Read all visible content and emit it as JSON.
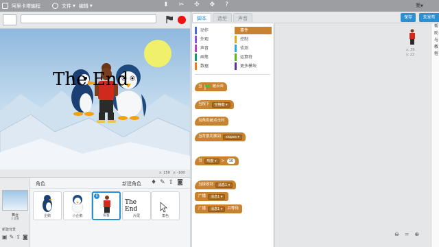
{
  "menubar": {
    "app_name": "阿里卡塔編程",
    "file_label": "文件",
    "edit_label": "编辑",
    "user_label": "我"
  },
  "stage": {
    "overlay_text": "The End",
    "mouse_x_label": "x:",
    "mouse_x": "150",
    "mouse_y_label": "y:",
    "mouse_y": "-100"
  },
  "stage_panel": {
    "name": "舞台",
    "backdrops": "3 背景",
    "new_backdrop": "新建背景"
  },
  "sprites": {
    "title": "角色",
    "new_sprite": "新建角色",
    "items": [
      {
        "name": "企鹅"
      },
      {
        "name": "小企鹅"
      },
      {
        "name": "说客"
      },
      {
        "name": "片尾",
        "thumb_text": "The End"
      },
      {
        "name": "角色"
      }
    ]
  },
  "tabs": {
    "scripts": "脚本",
    "costumes": "造型",
    "sounds": "声音"
  },
  "categories": [
    {
      "label": "动作",
      "color": "#4a6cd4"
    },
    {
      "label": "事件",
      "color": "#c88330",
      "selected": true
    },
    {
      "label": "外观",
      "color": "#8a55d7"
    },
    {
      "label": "控制",
      "color": "#e1a91a"
    },
    {
      "label": "声音",
      "color": "#bb42c3"
    },
    {
      "label": "侦测",
      "color": "#2ca5e2"
    },
    {
      "label": "画笔",
      "color": "#0e9a6c"
    },
    {
      "label": "运算符",
      "color": "#5cb712"
    },
    {
      "label": "数据",
      "color": "#ee7d16"
    },
    {
      "label": "更多模块",
      "color": "#632d99"
    }
  ],
  "blocks": {
    "when_flag_pre": "当",
    "when_flag_post": "被点击",
    "when_key_pre": "当按下",
    "when_key_value": "空格键",
    "when_sprite_clicked": "当角色被点击时",
    "when_backdrop_pre": "当背景切换到",
    "when_backdrop_value": "slopes",
    "when_loudness_pre": "当",
    "when_loudness_value": "响度",
    "when_loudness_op": ">",
    "when_loudness_num": "10",
    "when_receive_pre": "当接收到",
    "when_receive_value": "消息1",
    "broadcast_pre": "广播",
    "broadcast_value": "消息1",
    "broadcast_wait_pre": "广播",
    "broadcast_wait_value": "消息1",
    "broadcast_wait_post": "并等待"
  },
  "scripts_area": {
    "sprite_x": "x: 39",
    "sprite_y": "y: 22"
  },
  "header_buttons": {
    "save": "保存",
    "share": "去发布"
  },
  "help": [
    "帮",
    "助",
    "与",
    "教",
    "程"
  ],
  "colors": {
    "events": "#c88330",
    "accent": "#2a90d5",
    "stop": "#ee1111"
  }
}
